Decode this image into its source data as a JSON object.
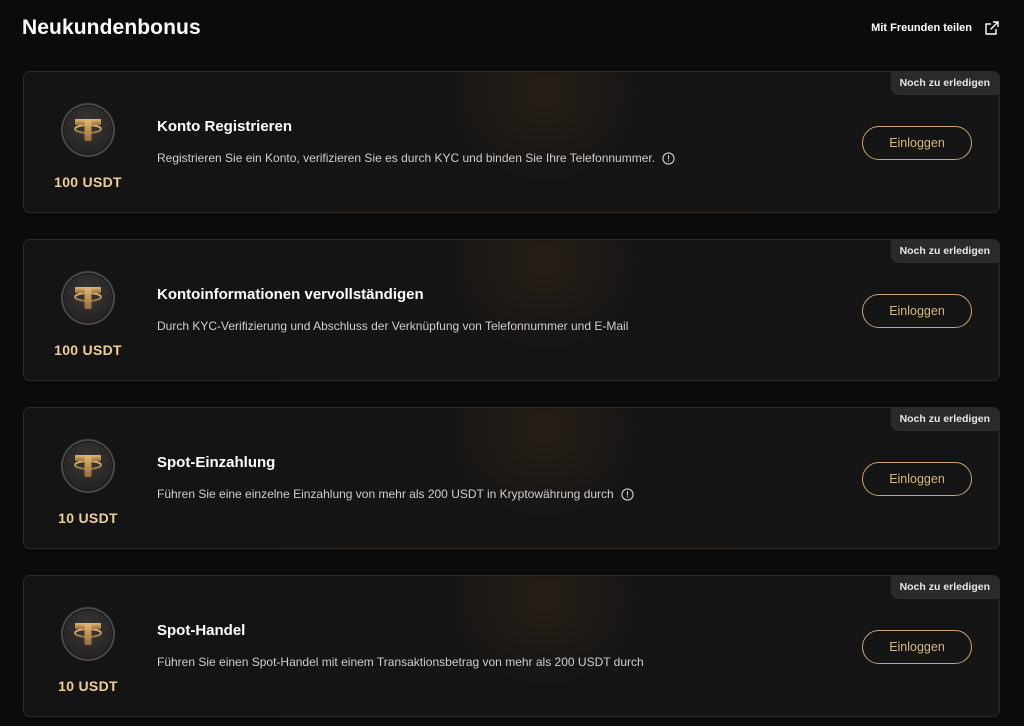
{
  "header": {
    "title": "Neukundenbonus",
    "share_label": "Mit Freunden teilen",
    "share_icon": "share-icon"
  },
  "colors": {
    "background": "#0b0b0b",
    "card": "#151515",
    "gold_accent": "#caa46c",
    "amount_text": "#f0cd94",
    "badge_bg": "#2a2a2a"
  },
  "tasks": [
    {
      "badge": "Noch zu erledigen",
      "coin_icon": "tether-coin-icon",
      "amount": "100 USDT",
      "title": "Konto Registrieren",
      "description": "Registrieren Sie ein Konto, verifizieren Sie es durch KYC und binden Sie Ihre Telefonnummer.",
      "has_info": true,
      "button": "Einloggen"
    },
    {
      "badge": "Noch zu erledigen",
      "coin_icon": "tether-coin-icon",
      "amount": "100 USDT",
      "title": "Kontoinformationen vervollständigen",
      "description": "Durch KYC-Verifizierung und Abschluss der Verknüpfung von Telefonnummer und E-Mail",
      "has_info": false,
      "button": "Einloggen"
    },
    {
      "badge": "Noch zu erledigen",
      "coin_icon": "tether-coin-icon",
      "amount": "10 USDT",
      "title": "Spot-Einzahlung",
      "description": "Führen Sie eine einzelne Einzahlung von mehr als 200 USDT in Kryptowährung durch",
      "has_info": true,
      "button": "Einloggen"
    },
    {
      "badge": "Noch zu erledigen",
      "coin_icon": "tether-coin-icon",
      "amount": "10 USDT",
      "title": "Spot-Handel",
      "description": "Führen Sie einen Spot-Handel mit einem Transaktionsbetrag von mehr als 200 USDT durch",
      "has_info": false,
      "button": "Einloggen"
    }
  ]
}
